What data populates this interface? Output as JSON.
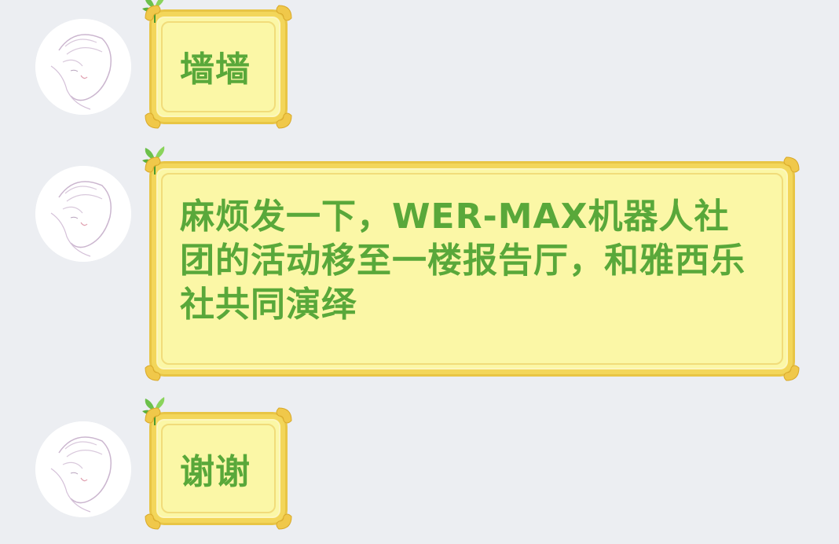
{
  "chat": {
    "messages": [
      {
        "text": "墙墙"
      },
      {
        "text": "麻烦发一下，WER-MAX机器人社团的活动移至一楼报告厅，和雅西乐社共同演绎"
      },
      {
        "text": "谢谢"
      }
    ]
  },
  "colors": {
    "background": "#eceef2",
    "bubble_fill": "#fbf7a6",
    "bubble_border": "#f3d65a",
    "text": "#59a83a",
    "leaf": "#6cc04a"
  },
  "icons": {
    "avatar": "avatar-sketch-icon",
    "bubble_leaf": "leaf-icon",
    "bubble_corner": "ornament-corner-icon"
  }
}
